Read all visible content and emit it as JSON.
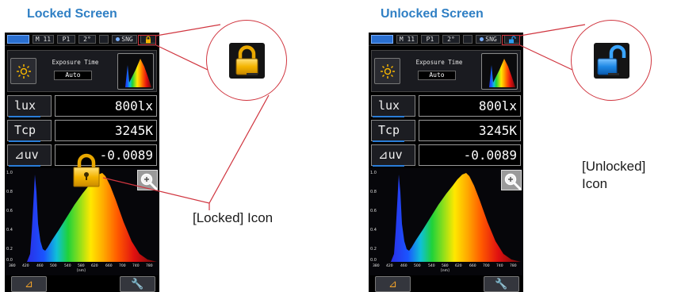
{
  "captions": {
    "locked": "Locked Screen",
    "unlocked": "Unlocked Screen"
  },
  "status_bar": {
    "meter": "M 11",
    "preset": "P1",
    "angle": "2°",
    "mode": "SNG"
  },
  "exposure": {
    "title": "Exposure Time",
    "value": "Auto"
  },
  "readings": [
    {
      "label": "lux",
      "value": "800lx"
    },
    {
      "label": "Tcp",
      "value": "3245K"
    },
    {
      "label": "⊿uv",
      "value": "-0.0089"
    }
  ],
  "graph": {
    "y_ticks": [
      "1.0",
      "0.8",
      "0.6",
      "0.4",
      "0.2",
      "0.0"
    ],
    "x_ticks": [
      "380",
      "420",
      "460",
      "500",
      "540",
      "580",
      "620",
      "660",
      "700",
      "740",
      "780"
    ],
    "x_unit": "[nm]"
  },
  "callouts": {
    "locked_icon": "[Locked] Icon",
    "unlocked_icon_line1": "[Unlocked]",
    "unlocked_icon_line2": "Icon"
  },
  "colors": {
    "caption": "#2f7fc4",
    "callout": "#d0353f",
    "lock_locked": "#f4b400",
    "lock_unlocked": "#1e88e5"
  },
  "icons": {
    "lock_locked": "padlock-closed-icon",
    "lock_unlocked": "padlock-open-icon",
    "zoom": "zoom-in-icon",
    "settings": "wrench-icon",
    "delta": "delta-icon",
    "light_source": "sun-icon"
  }
}
